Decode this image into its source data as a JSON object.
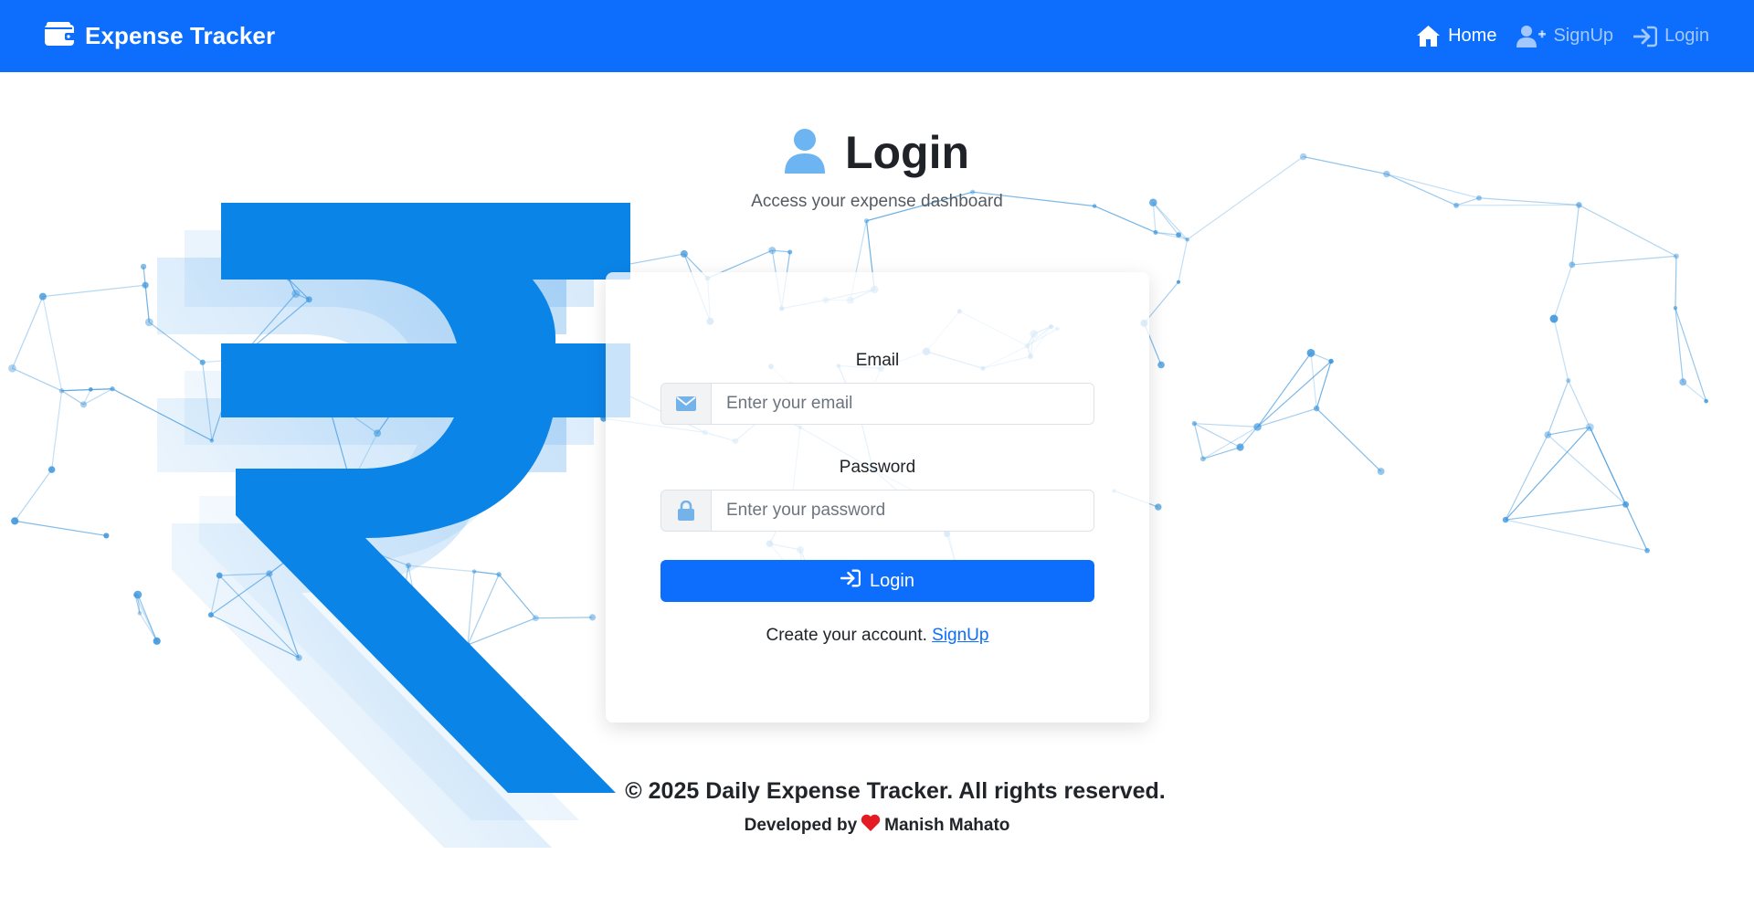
{
  "navbar": {
    "brand_title": "Expense Tracker",
    "brand_icon": "wallet-icon",
    "links": [
      {
        "label": "Home",
        "icon": "home-icon",
        "active": true
      },
      {
        "label": "SignUp",
        "icon": "user-plus-icon",
        "active": false
      },
      {
        "label": "Login",
        "icon": "sign-in-icon",
        "active": false
      }
    ]
  },
  "header": {
    "title": "Login",
    "subtitle": "Access your expense dashboard",
    "icon": "user-icon"
  },
  "form": {
    "email_label": "Email",
    "email_placeholder": "Enter your email",
    "email_value": "",
    "email_icon": "envelope-icon",
    "password_label": "Password",
    "password_placeholder": "Enter your password",
    "password_value": "",
    "password_icon": "lock-icon",
    "submit_label": "Login",
    "signup_prompt": "Create your account.",
    "signup_link": "SignUp"
  },
  "footer": {
    "copyright": "© 2025 Daily Expense Tracker. All rights reserved.",
    "developed_by": "Developed by",
    "developer": "Manish Mahato"
  },
  "colors": {
    "primary": "#0d6efd",
    "rupee_blue": "#0b84e8",
    "network_blue": "#3b95dc",
    "heart": "#e41b23"
  }
}
